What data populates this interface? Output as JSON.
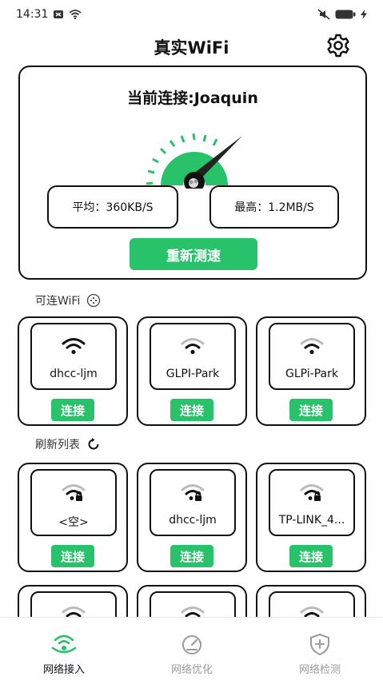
{
  "status_bar": {
    "time": "14:31"
  },
  "header": {
    "title": "真实WiFi"
  },
  "speed_card": {
    "title": "当前连接:Joaquin",
    "average": "平均：360KB/S",
    "max": "最高：1.2MB/S",
    "retest_label": "重新测速"
  },
  "available_section": {
    "label": "可连WiFi"
  },
  "refresh_section": {
    "label": "刷新列表"
  },
  "connect_label": "连接",
  "available_networks": [
    {
      "name": "dhcc-ljm"
    },
    {
      "name": "GLPI-Park"
    },
    {
      "name": "GLPi-Park"
    }
  ],
  "refresh_networks": [
    {
      "name": "<空>"
    },
    {
      "name": "dhcc-ljm"
    },
    {
      "name": "TP-LINK_4..."
    }
  ],
  "bottom_nav": [
    {
      "label": "网络接入"
    },
    {
      "label": "网络优化"
    },
    {
      "label": "网络检测"
    }
  ],
  "colors": {
    "accent": "#27c26a",
    "inactive": "#9a9a9a",
    "border": "#111111"
  }
}
